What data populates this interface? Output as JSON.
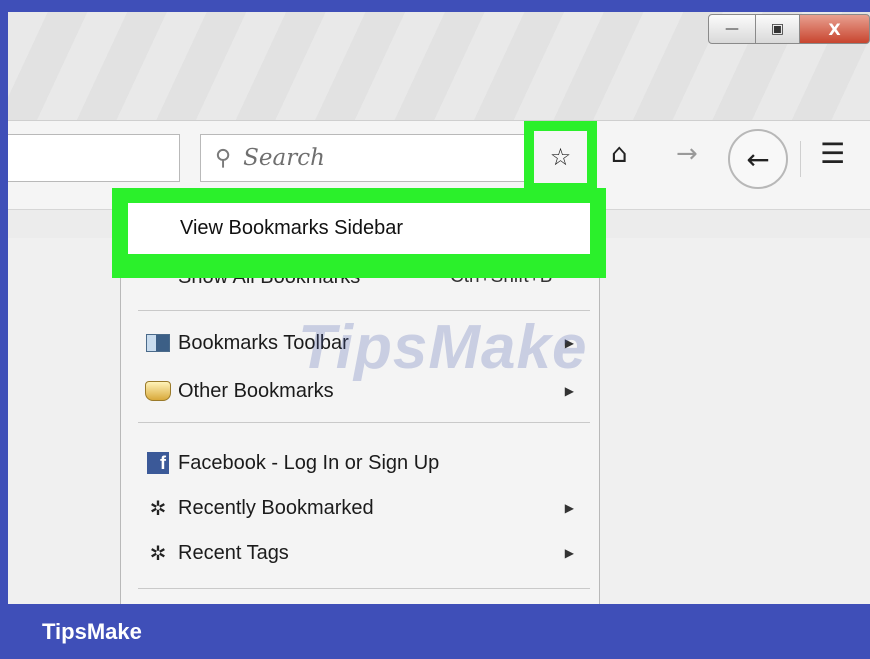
{
  "window": {
    "minimize_glyph": "—",
    "maximize_glyph": "▣",
    "close_glyph": "X"
  },
  "toolbar": {
    "search_placeholder": "Search",
    "search_icon": "search-icon",
    "bookmark_icon": "bookmark-star-icon",
    "home_icon": "home-icon",
    "forward_icon": "forward-arrow-icon",
    "back_icon": "back-arrow-icon",
    "menu_icon": "hamburger-menu-icon"
  },
  "bookmarks_menu": {
    "view_sidebar": "View Bookmarks Sidebar",
    "show_all": "Show All Bookmarks",
    "show_all_shortcut": "Ctrl+Shift+B",
    "items": [
      {
        "label": "Bookmarks Toolbar",
        "icon": "bookmarks-toolbar-icon",
        "submenu": true
      },
      {
        "label": "Other Bookmarks",
        "icon": "other-bookmarks-icon",
        "submenu": true
      },
      {
        "label": "Facebook - Log In or Sign Up",
        "icon": "facebook-icon",
        "submenu": false
      },
      {
        "label": "Recently Bookmarked",
        "icon": "gear-icon",
        "submenu": true
      },
      {
        "label": "Recent Tags",
        "icon": "gear-icon",
        "submenu": true
      }
    ]
  },
  "colors": {
    "highlight": "#2bf02b",
    "frame": "#3f4fb8"
  },
  "watermark": "TipsMake",
  "footer": {
    "brand": "TipsMake"
  }
}
